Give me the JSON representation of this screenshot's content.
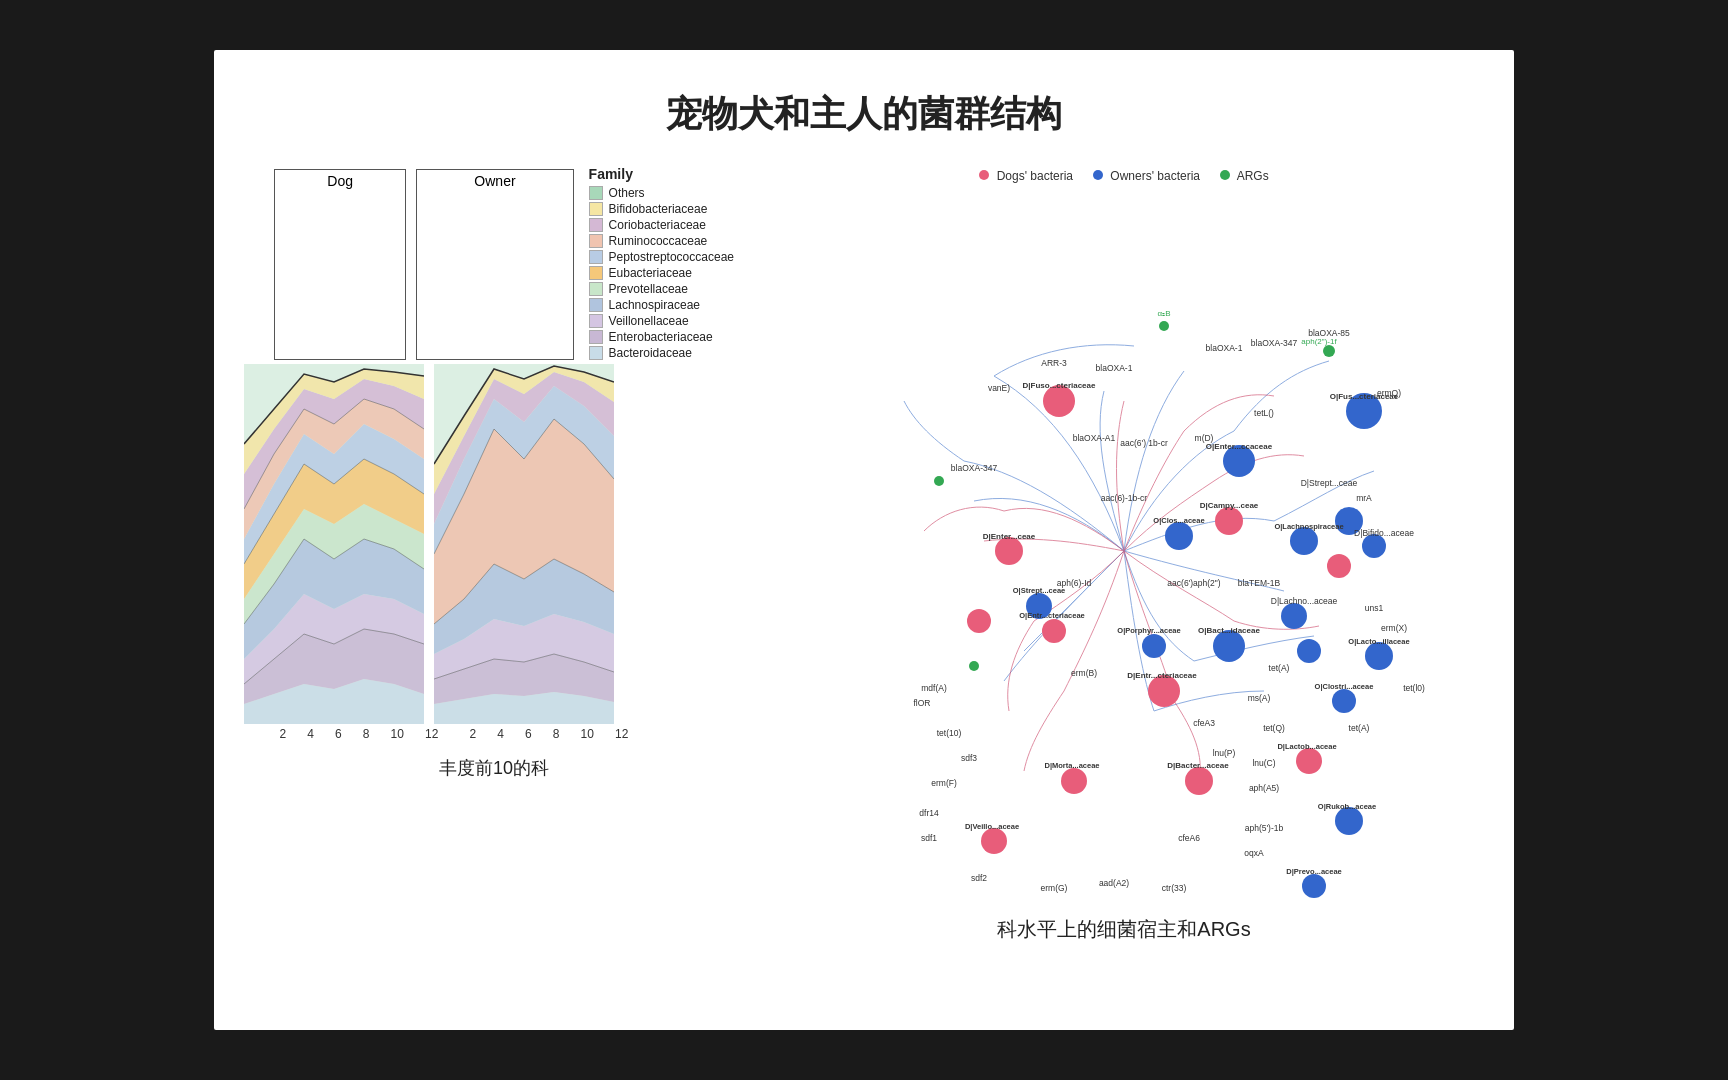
{
  "title": "宠物犬和主人的菌群结构",
  "left": {
    "dog_label": "Dog",
    "owner_label": "Owner",
    "x_ticks": [
      "2",
      "4",
      "6",
      "8",
      "10",
      "12"
    ],
    "caption": "丰度前10的科",
    "legend_title": "Family",
    "legend_items": [
      {
        "label": "Others",
        "color": "#a8d8b9"
      },
      {
        "label": "Bifidobacteriaceae",
        "color": "#f5e6a3"
      },
      {
        "label": "Coriobacteriaceae",
        "color": "#d4b8d4"
      },
      {
        "label": "Ruminococcaceae",
        "color": "#f0c4b0"
      },
      {
        "label": "Peptostreptococcaceae",
        "color": "#b8cce4"
      },
      {
        "label": "Eubacteriaceae",
        "color": "#f5c87a"
      },
      {
        "label": "Prevotellaceae",
        "color": "#c8e6c9"
      },
      {
        "label": "Lachnospiraceae",
        "color": "#b0c4de"
      },
      {
        "label": "Veillonellaceae",
        "color": "#d4c5e2"
      },
      {
        "label": "Enterobacteriaceae",
        "color": "#c8b8d4"
      },
      {
        "label": "Bacteroidaceae",
        "color": "#c8dce8"
      }
    ]
  },
  "right": {
    "legend_items": [
      {
        "label": "Dogs' bacteria",
        "color": "#e85d7a"
      },
      {
        "label": "Owners' bacteria",
        "color": "#3366cc"
      },
      {
        "label": "ARGs",
        "color": "#33a853"
      }
    ],
    "caption": "科水平上的细菌宿主和ARGs"
  }
}
